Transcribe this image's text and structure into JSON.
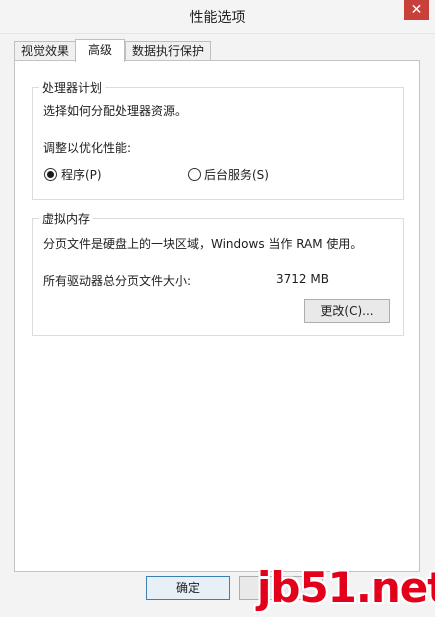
{
  "window": {
    "title": "性能选项",
    "close_glyph": "✕"
  },
  "tabs": [
    {
      "label": "视觉效果"
    },
    {
      "label": "高级",
      "active": true
    },
    {
      "label": "数据执行保护"
    }
  ],
  "processor": {
    "title": "处理器计划",
    "description": "选择如何分配处理器资源。",
    "optimize_label": "调整以优化性能:",
    "options": [
      {
        "label": "程序(P)",
        "checked": true
      },
      {
        "label": "后台服务(S)",
        "checked": false
      }
    ]
  },
  "virtual_memory": {
    "title": "虚拟内存",
    "description": "分页文件是硬盘上的一块区域，Windows 当作 RAM 使用。",
    "total_label": "所有驱动器总分页文件大小:",
    "total_value": "3712 MB",
    "change_button": "更改(C)..."
  },
  "footer": {
    "ok_button": "确定"
  },
  "watermark": "jb51.net",
  "colors": {
    "close": "#c7403a",
    "watermark": "#e3001b",
    "focus_border": "#3c7fb1"
  }
}
